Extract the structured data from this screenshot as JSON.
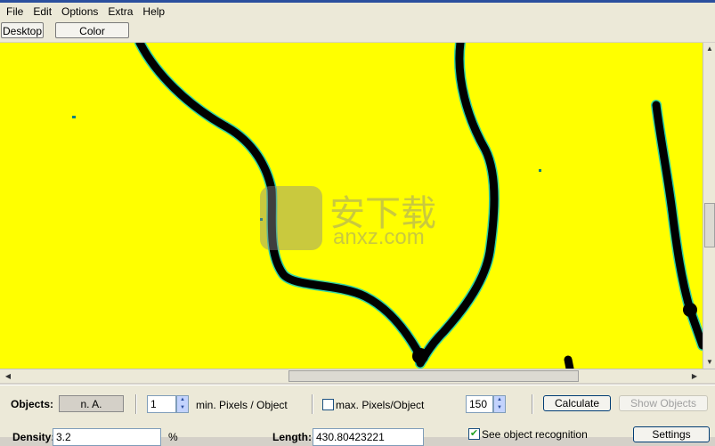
{
  "menu": [
    "File",
    "Edit",
    "Options",
    "Extra",
    "Help"
  ],
  "toolbar": {
    "desktop": "Desktop",
    "color_histogram": "Color Histogram"
  },
  "colors": {
    "background": "#ffff00",
    "lines": "#000000",
    "outline": "#00c8c8"
  },
  "watermark": {
    "text": "安下载",
    "subtext": "anxz.com"
  },
  "panel": {
    "objects_label": "Objects:",
    "objects_value": "n. A.",
    "min_pixels_value": "1",
    "min_pixels_label": "min. Pixels / Object",
    "max_pixels_label": "max. Pixels/Object",
    "max_pixels_checked": false,
    "max_pixels_value": "150",
    "calculate": "Calculate",
    "show_objects": "Show Objects",
    "density_label": "Density:",
    "density_value": "3.2",
    "density_unit": "%",
    "length_label": "Length:",
    "length_value": "430.80423221",
    "see_object_recognition": "See object recognition",
    "see_object_checked": true,
    "settings": "Settings"
  }
}
